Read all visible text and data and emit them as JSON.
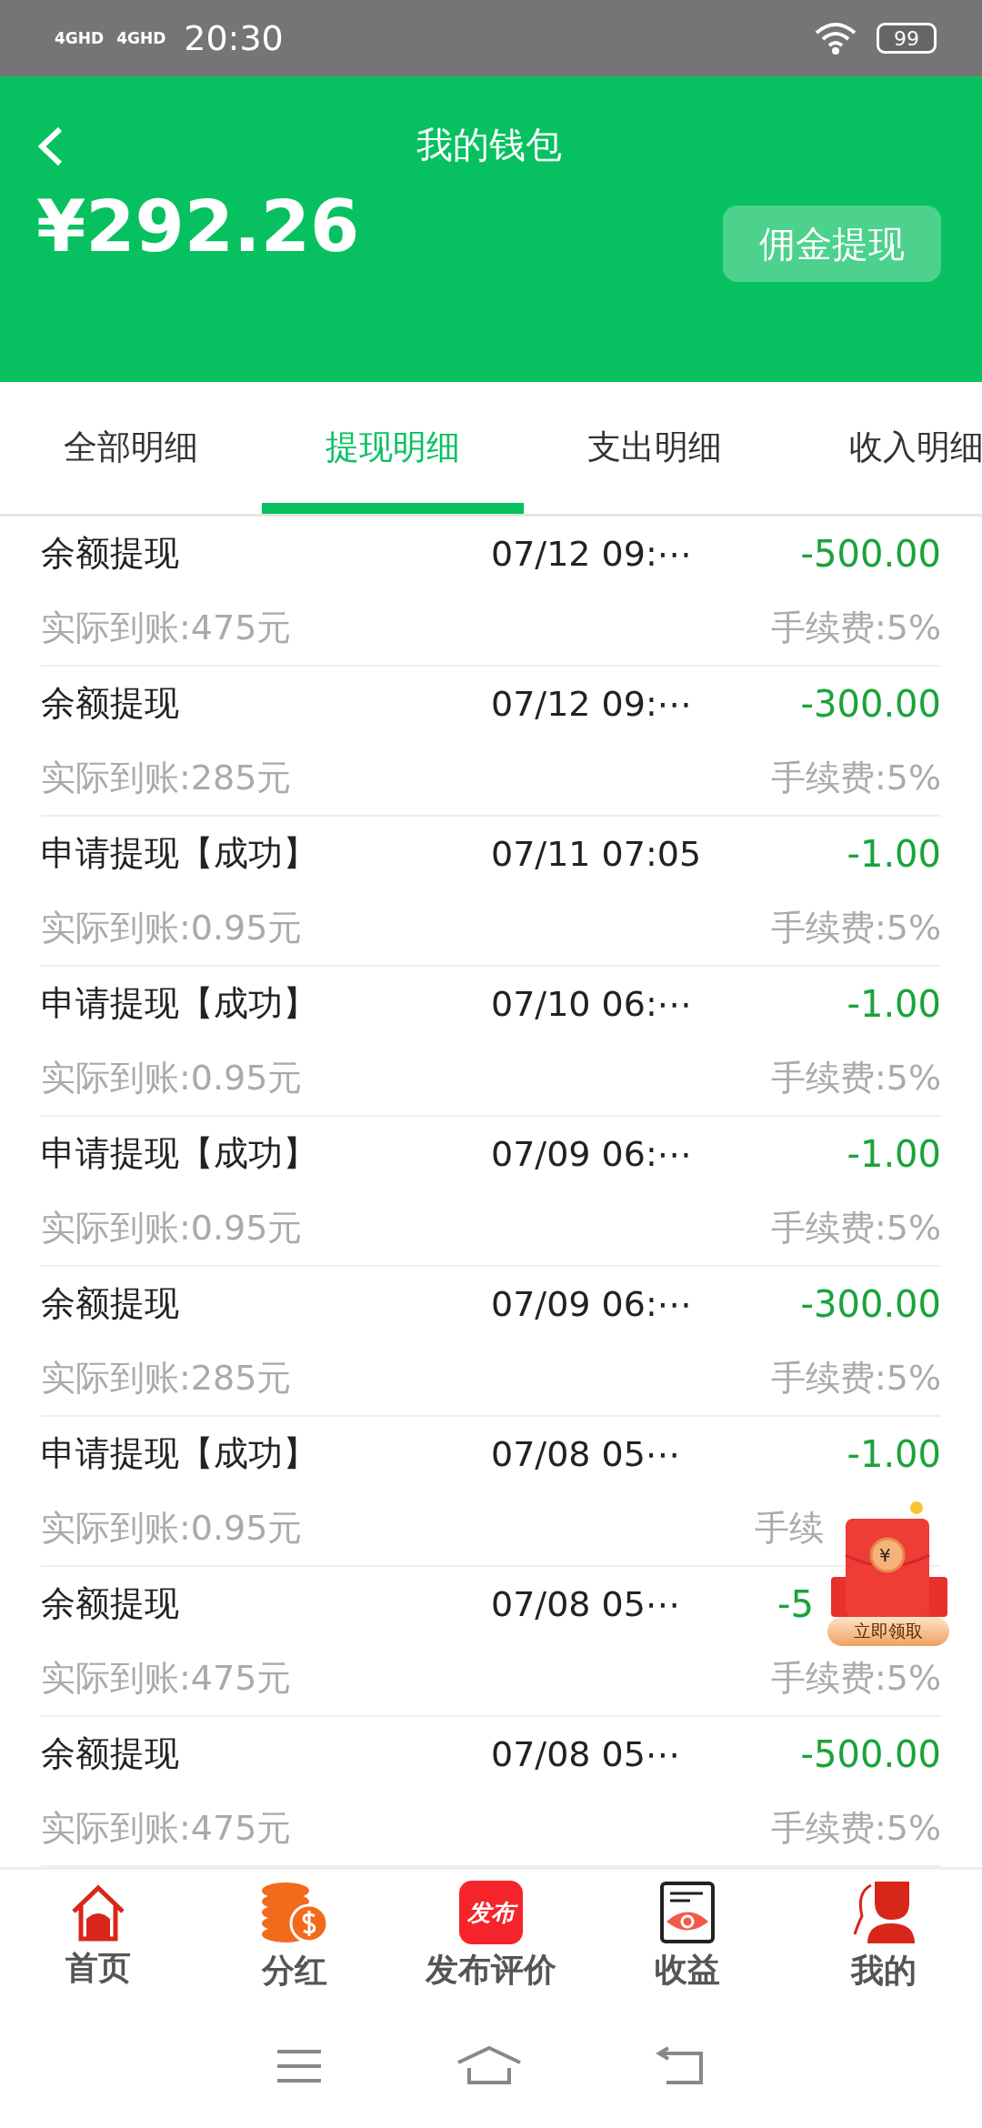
{
  "status_bar": {
    "network_1": "4GHD",
    "network_2": "4GHD",
    "time": "20:30",
    "battery": "99"
  },
  "header": {
    "title": "我的钱包",
    "balance": "¥292.26",
    "withdraw_button": "佣金提现"
  },
  "tabs": [
    {
      "label": "全部明细",
      "selected": false
    },
    {
      "label": "提现明细",
      "selected": true
    },
    {
      "label": "支出明细",
      "selected": false
    },
    {
      "label": "收入明细",
      "selected": false
    }
  ],
  "records": [
    {
      "title": "余额提现",
      "time": "07/12 09:⋯",
      "amount": "-500.00",
      "received": "实际到账:475元",
      "fee": "手续费:5%"
    },
    {
      "title": "余额提现",
      "time": "07/12 09:⋯",
      "amount": "-300.00",
      "received": "实际到账:285元",
      "fee": "手续费:5%"
    },
    {
      "title": "申请提现【成功】",
      "time": "07/11 07:05",
      "amount": "-1.00",
      "received": "实际到账:0.95元",
      "fee": "手续费:5%"
    },
    {
      "title": "申请提现【成功】",
      "time": "07/10 06:⋯",
      "amount": "-1.00",
      "received": "实际到账:0.95元",
      "fee": "手续费:5%"
    },
    {
      "title": "申请提现【成功】",
      "time": "07/09 06:⋯",
      "amount": "-1.00",
      "received": "实际到账:0.95元",
      "fee": "手续费:5%"
    },
    {
      "title": "余额提现",
      "time": "07/09 06:⋯",
      "amount": "-300.00",
      "received": "实际到账:285元",
      "fee": "手续费:5%"
    },
    {
      "title": "申请提现【成功】",
      "time": "07/08 05⋯",
      "amount": "-1.00",
      "received": "实际到账:0.95元",
      "fee": "手续",
      "fee_covered": true
    },
    {
      "title": "余额提现",
      "time": "07/08 05⋯",
      "amount": "-5",
      "received": "实际到账:475元",
      "fee": "手续费:5%",
      "amount_covered": true
    },
    {
      "title": "余额提现",
      "time": "07/08 05⋯",
      "amount": "-500.00",
      "received": "实际到账:475元",
      "fee": "手续费:5%"
    }
  ],
  "red_packet": {
    "symbol": "¥",
    "label": "立即领取"
  },
  "bottom_nav": [
    {
      "kind": "home",
      "label": "首页"
    },
    {
      "kind": "coins",
      "label": "分红"
    },
    {
      "kind": "publish",
      "label": "发布评价",
      "badge_text": "发布"
    },
    {
      "kind": "earnings",
      "label": "收益"
    },
    {
      "kind": "profile",
      "label": "我的"
    }
  ]
}
